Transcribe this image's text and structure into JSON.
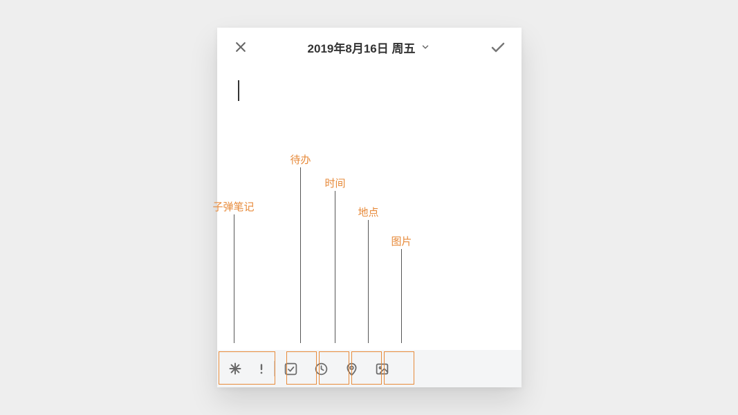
{
  "header": {
    "date_label": "2019年8月16日 周五"
  },
  "callouts": {
    "bullet_note": "子弹笔记",
    "todo": "待办",
    "time": "时间",
    "location": "地点",
    "image": "图片"
  },
  "colors": {
    "accent": "#e78a3a"
  }
}
